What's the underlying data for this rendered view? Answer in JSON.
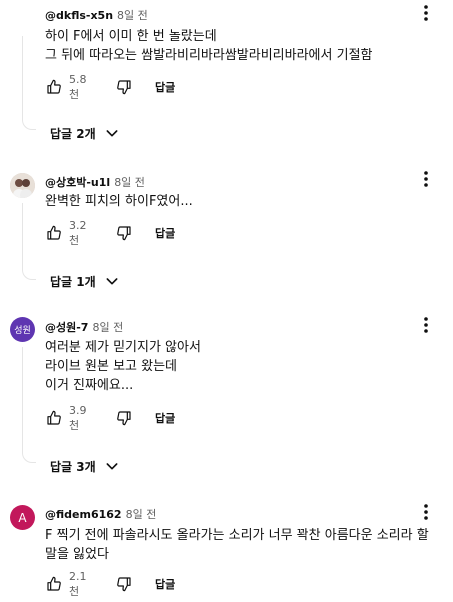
{
  "comments": [
    {
      "author": "@dkfls-x5n",
      "time": "8일 전",
      "text": "하이 F에서 이미 한 번 놀랐는데\n그 뒤에 따라오는 쌈발라비리바라쌈발라비리바라에서 기절함",
      "likes": "5.8천",
      "reply_label": "답글",
      "replies_label": "답글 2개",
      "avatar": {
        "type": "none"
      }
    },
    {
      "author": "@상호박-u1l",
      "time": "8일 전",
      "text": "완벽한 피치의 하이F였어...",
      "likes": "3.2천",
      "reply_label": "답글",
      "replies_label": "답글 1개",
      "avatar": {
        "type": "photo"
      }
    },
    {
      "author": "@성원-7",
      "time": "8일 전",
      "text": "여러분 제가 믿기지가 않아서\n라이브 원본 보고 왔는데\n이거 진짜에요...",
      "likes": "3.9천",
      "reply_label": "답글",
      "replies_label": "답글 3개",
      "avatar": {
        "type": "text",
        "label": "성원",
        "color": "#5e35b1"
      }
    },
    {
      "author": "@fidem6162",
      "time": "8일 전",
      "text": "F 찍기 전에 파솔라시도 올라가는 소리가 너무  꽉찬 아름다운 소리라 할 말을 잃었다",
      "likes": "2.1천",
      "reply_label": "답글",
      "avatar": {
        "type": "text",
        "label": "A",
        "color": "#c2185b"
      }
    }
  ],
  "icons": {
    "like": "thumbs-up-icon",
    "dislike": "thumbs-down-icon",
    "more": "more-vert-icon",
    "expand": "chevron-down-icon"
  }
}
